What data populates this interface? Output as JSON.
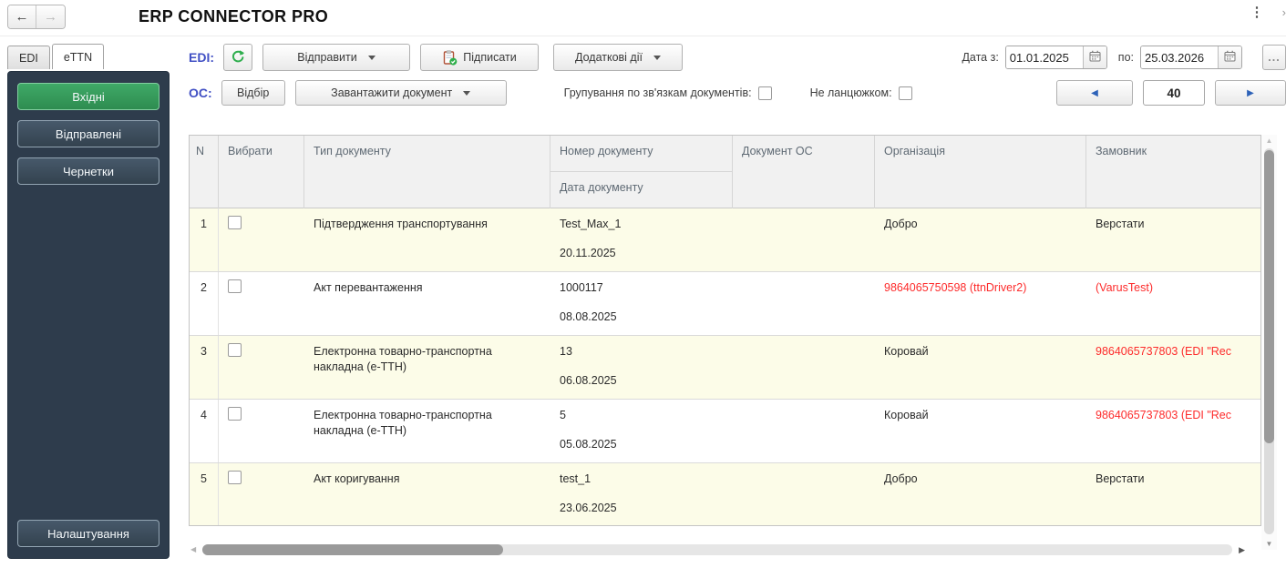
{
  "topbar": {
    "title": "ERP CONNECTOR PRO",
    "back_arrow": "←",
    "forward_arrow": "→",
    "menu_icon": "⋮",
    "edge_chevron": "›"
  },
  "sidebar": {
    "tabs": [
      {
        "label": "EDI"
      },
      {
        "label": "eTTN"
      }
    ],
    "buttons": [
      {
        "label": "Вхідні",
        "active": true
      },
      {
        "label": "Відправлені",
        "active": false
      },
      {
        "label": "Чернетки",
        "active": false
      }
    ],
    "settings_label": "Налаштування"
  },
  "toolbar_edi": {
    "label": "EDI:",
    "refresh_icon": "refresh",
    "send_label": "Відправити",
    "sign_label": "Підписати",
    "more_label": "Додаткові дії",
    "date_from_label": "Дата з:",
    "date_from_value": "01.01.2025",
    "date_to_label": "по:",
    "date_to_value": "25.03.2026",
    "ellipsis_label": "..."
  },
  "toolbar_oc": {
    "label": "ОС:",
    "filter_label": "Відбір",
    "load_label": "Завантажити документ",
    "group_label": "Групування по зв'язкам документів:",
    "group_checked": false,
    "chain_label": "Не ланцюжком:",
    "chain_checked": false,
    "prev_icon": "◀",
    "next_icon": "▶",
    "page_size": "40"
  },
  "table": {
    "headers": {
      "n": "N",
      "select": "Вибрати",
      "doc_type": "Тип документу",
      "doc_number": "Номер документу",
      "doc_date": "Дата документу",
      "doc_os": "Документ ОС",
      "organization": "Організація",
      "customer": "Замовник"
    },
    "rows": [
      {
        "n": "1",
        "type": "Підтвердження транспортування",
        "number": "Test_Max_1",
        "date": "20.11.2025",
        "doc_os": "",
        "org": "Добро",
        "org_red": false,
        "customer": "Верстати",
        "customer_red": false
      },
      {
        "n": "2",
        "type": "Акт перевантаження",
        "number": "1000117",
        "date": "08.08.2025",
        "doc_os": "",
        "org": "9864065750598 (ttnDriver2)",
        "org_red": true,
        "customer": "(VarusTest)",
        "customer_red": true
      },
      {
        "n": "3",
        "type": "Електронна товарно-транспортна накладна (е-ТТН)",
        "number": "13",
        "date": "06.08.2025",
        "doc_os": "",
        "org": "Коровай",
        "org_red": false,
        "customer": "9864065737803 (EDI \"Rec",
        "customer_red": true
      },
      {
        "n": "4",
        "type": "Електронна товарно-транспортна накладна (е-ТТН)",
        "number": "5",
        "date": "05.08.2025",
        "doc_os": "",
        "org": "Коровай",
        "org_red": false,
        "customer": "9864065737803 (EDI \"Rec",
        "customer_red": true
      },
      {
        "n": "5",
        "type": "Акт коригування",
        "number": "test_1",
        "date": "23.06.2025",
        "doc_os": "",
        "org": "Добро",
        "org_red": false,
        "customer": "Верстати",
        "customer_red": false
      }
    ]
  },
  "colors": {
    "accent_blue": "#4150c4",
    "button_green": "#3fa967",
    "sidebar_bg": "#2e3c4c",
    "red_text": "#fd2b2b",
    "row_alt_bg": "#fcfce8"
  }
}
